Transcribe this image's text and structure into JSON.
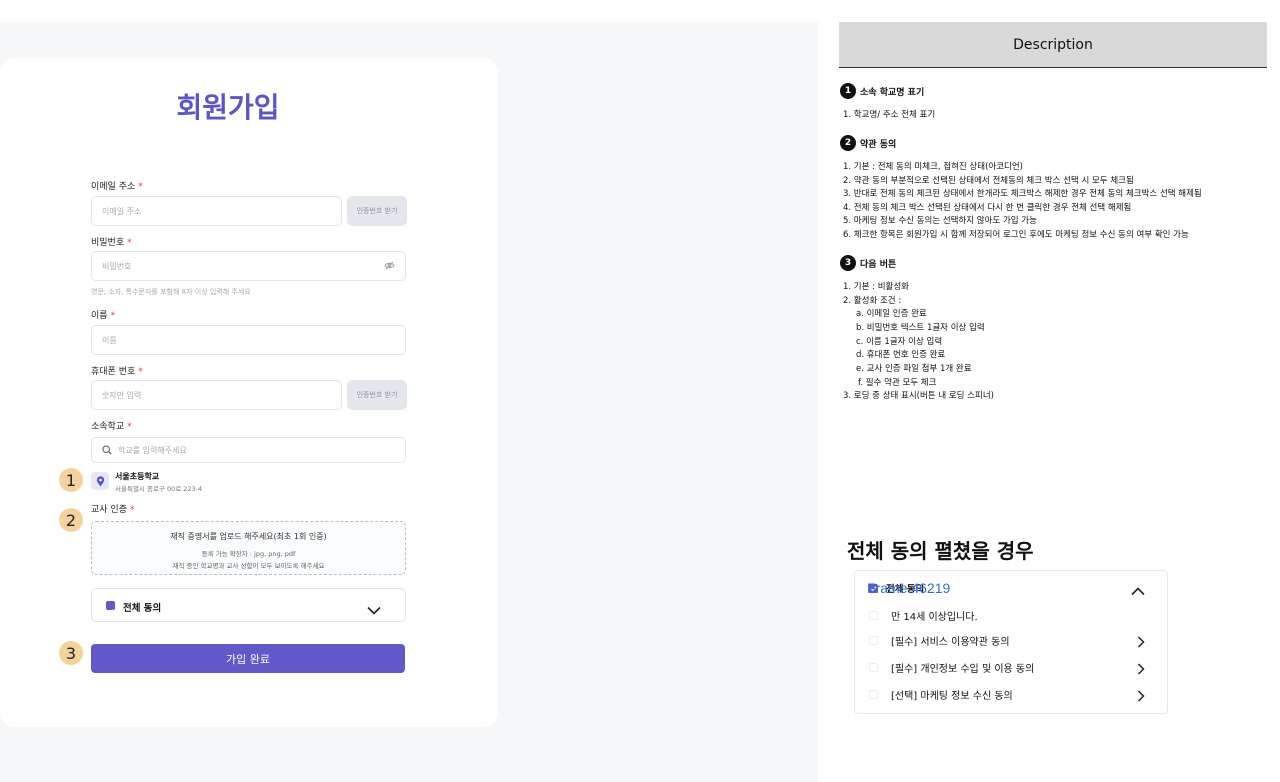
{
  "form": {
    "title": "회원가입",
    "email": {
      "label": "이메일 주소",
      "placeholder": "이메일 주소",
      "button": "인증번호 받기"
    },
    "password": {
      "label": "비밀번호",
      "placeholder": "비밀번호",
      "hint": "영문, 소자, 특수문자를 포함해 8자 이상 입력해 주세요"
    },
    "name": {
      "label": "이름",
      "placeholder": "이름"
    },
    "phone": {
      "label": "휴대폰 번호",
      "placeholder": "숫자만 입력",
      "button": "인증번호 받기"
    },
    "school": {
      "label": "소속학교",
      "placeholder": "학교를 입력해주세요",
      "selected_name": "서울초등학교",
      "selected_address": "서울특별시 종로구 00로 223-4"
    },
    "teacher": {
      "label": "교사 인증",
      "upload_title": "재직 증명서를 업로드 해주세요(최초 1회 인증)",
      "upload_ext": "등록 가능 확장자 : jpg, png, pdf",
      "upload_note": "재직 중인 학교명과 교사 성함이 모두 보이도록 해주세요"
    },
    "agree_all": "전체 동의",
    "submit": "가입 완료",
    "required_mark": "*"
  },
  "markers": [
    "1",
    "2",
    "3"
  ],
  "description": {
    "header": "Description",
    "sections": [
      {
        "num": "1",
        "title": "소속 학교명 표기",
        "lines": [
          "1. 학교명/ 주소 전체 표기"
        ]
      },
      {
        "num": "2",
        "title": "약관 동의",
        "lines": [
          "1. 기본 : 전체 동의 미체크, 접혀진 상태(아코디언)",
          "2. 약관 동의 부분적으로 선택된 상태에서 전체동의 체크 박스 선택 시 모두 체크됨",
          "3. 반대로 전체 동의 체크된 상태에서 한개라도 체크박스 해제한 경우 전체 동의 체크박스 선택 해제됨",
          "4. 전체 동의 체크 박스 선택된 상태에서 다시 한 번 클릭한 경우 전체 선택 해제됨",
          "5. 마케팅 정보 수신 동의는 선택하지 않아도 가입 가능",
          "6. 체크한 항목은 회원가입 시 함께 저장되어 로그인 후에도 마케팅 정보 수신 동의 여부 확인 가능"
        ]
      },
      {
        "num": "3",
        "title": "다음 버튼",
        "lines": [
          "1. 기본 : 비활성화",
          "2. 활성화 조건 :",
          "a. 이메일 인증 완료",
          "b. 비밀번호 텍스트 1글자 이상 입력",
          "c. 이름 1글자 이상 입력",
          "d. 휴대폰 번호 인증 완료",
          "e. 교사 인증 파일 첨부 1개 완료",
          "f. 필수 약관 모두 체크",
          "3. 로딩 중 상태 표시(버튼 내 로딩 스피너)"
        ]
      }
    ]
  },
  "expanded": {
    "heading": "전체 동의 펼쳤을 경우",
    "frame_label": "Frame 46219",
    "agree_all": "전체 동의",
    "items": [
      {
        "label": "만 14세 이상입니다.",
        "has_arrow": false
      },
      {
        "label": "[필수] 서비스 이용약관 동의",
        "has_arrow": true
      },
      {
        "label": "[필수] 개인정보 수입 및 이용 동의",
        "has_arrow": true
      },
      {
        "label": "[선택] 마케팅 정보 수신 동의",
        "has_arrow": true
      }
    ]
  },
  "colors": {
    "accent": "#6158cb",
    "title": "#5b55c9",
    "marker": "#f3d39b",
    "required": "#e23a3a",
    "frame_label": "#2a6fd6"
  },
  "icons": [
    "location-pin-icon",
    "eye-off-icon",
    "search-icon",
    "check-icon",
    "chevron-down-icon",
    "chevron-up-icon",
    "chevron-right-icon"
  ]
}
